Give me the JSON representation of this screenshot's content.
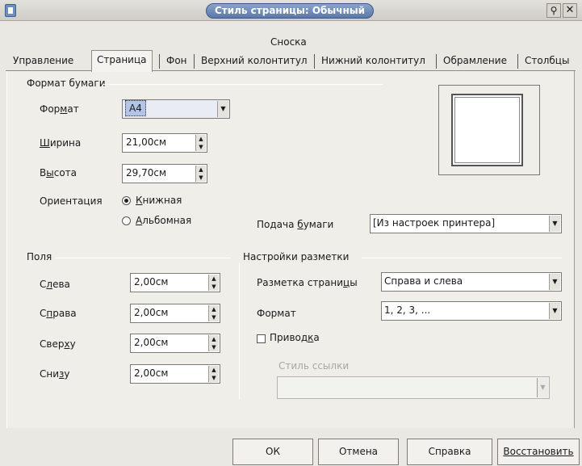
{
  "window": {
    "title": "Стиль страницы: Обычный",
    "pin_glyph": "⚲",
    "close_glyph": "✕"
  },
  "tabs": {
    "footnote": "Сноска",
    "items": [
      "Управление",
      "Страница",
      "Фон",
      "Верхний колонтитул",
      "Нижний колонтитул",
      "Обрамление",
      "Столбцы"
    ],
    "active": "Страница"
  },
  "paper": {
    "group_title": "Формат бумаги",
    "format_label_pre": "Фор",
    "format_label_u": "м",
    "format_label_post": "ат",
    "format_value": "A4",
    "width_label_pre": "",
    "width_label_u": "Ш",
    "width_label_post": "ирина",
    "width_value": "21,00см",
    "height_label_pre": "В",
    "height_label_u": "ы",
    "height_label_post": "сота",
    "height_value": "29,70см",
    "orientation_label": "Ориентация",
    "portrait_label_pre": "",
    "portrait_label_u": "К",
    "portrait_label_post": "нижная",
    "landscape_label_pre": "",
    "landscape_label_u": "А",
    "landscape_label_post": "льбомная",
    "orientation_selected": "portrait",
    "tray_label_pre": "Подача ",
    "tray_label_u": "б",
    "tray_label_post": "умаги",
    "tray_value": "[Из настроек принтера]"
  },
  "margins": {
    "group_title": "Поля",
    "left_label_pre": "С",
    "left_label_u": "л",
    "left_label_post": "ева",
    "left_value": "2,00см",
    "right_label_pre": "С",
    "right_label_u": "п",
    "right_label_post": "рава",
    "right_value": "2,00см",
    "top_label_pre": "Свер",
    "top_label_u": "х",
    "top_label_post": "у",
    "top_value": "2,00см",
    "bottom_label_pre": "Сни",
    "bottom_label_u": "з",
    "bottom_label_post": "у",
    "bottom_value": "2,00см"
  },
  "layout": {
    "group_title": "Настройки разметки",
    "page_layout_label_pre": "Разметка страни",
    "page_layout_label_u": "ц",
    "page_layout_label_post": "ы",
    "page_layout_value": "Справа и слева",
    "format_label": "Формат",
    "format_value": "1, 2, 3, ...",
    "register_label_pre": "Привод",
    "register_label_u": "к",
    "register_label_post": "а",
    "register_checked": false,
    "ref_style_label": "Стиль ссылки",
    "ref_style_value": ""
  },
  "buttons": {
    "ok": "ОК",
    "cancel": "Отмена",
    "help": "Справка",
    "reset": "Восстановить"
  },
  "colors": {
    "title_pill": "#5b78aa",
    "panel_bg": "#efeee9",
    "window_bg": "#e9e8e3"
  }
}
